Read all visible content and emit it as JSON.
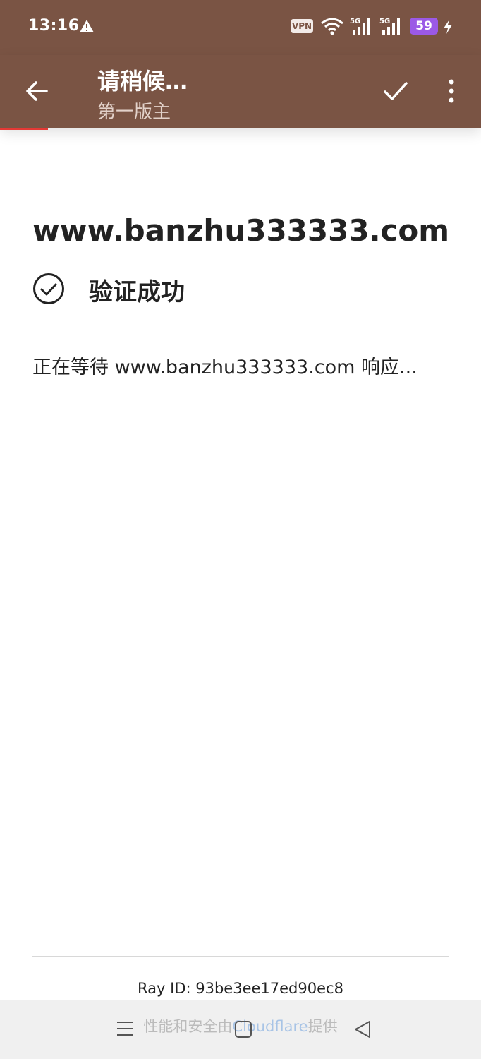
{
  "status_bar": {
    "time": "13:16",
    "vpn": "VPN",
    "signal_1": "5G",
    "signal_2": "5G",
    "battery": "59"
  },
  "app_bar": {
    "title": "请稍候…",
    "subtitle": "第一版主",
    "background_color": "#7a5444",
    "progress_color": "#e53935",
    "icons": [
      "back-arrow-icon",
      "checkmark-icon",
      "more-vert-icon"
    ]
  },
  "page": {
    "domain": "www.banzhu333333.com",
    "verify_status": "验证成功",
    "waiting_message": "正在等待 www.banzhu333333.com 响应...",
    "ray_id": "Ray ID: 93be3ee17ed90ec8",
    "cloudflare_prefix": "性能和安全由",
    "cloudflare_link": "Cloudflare",
    "cloudflare_suffix": "提供"
  },
  "nav_bar": {
    "icons": [
      "menu-icon",
      "home-icon",
      "back-triangle-icon"
    ]
  }
}
